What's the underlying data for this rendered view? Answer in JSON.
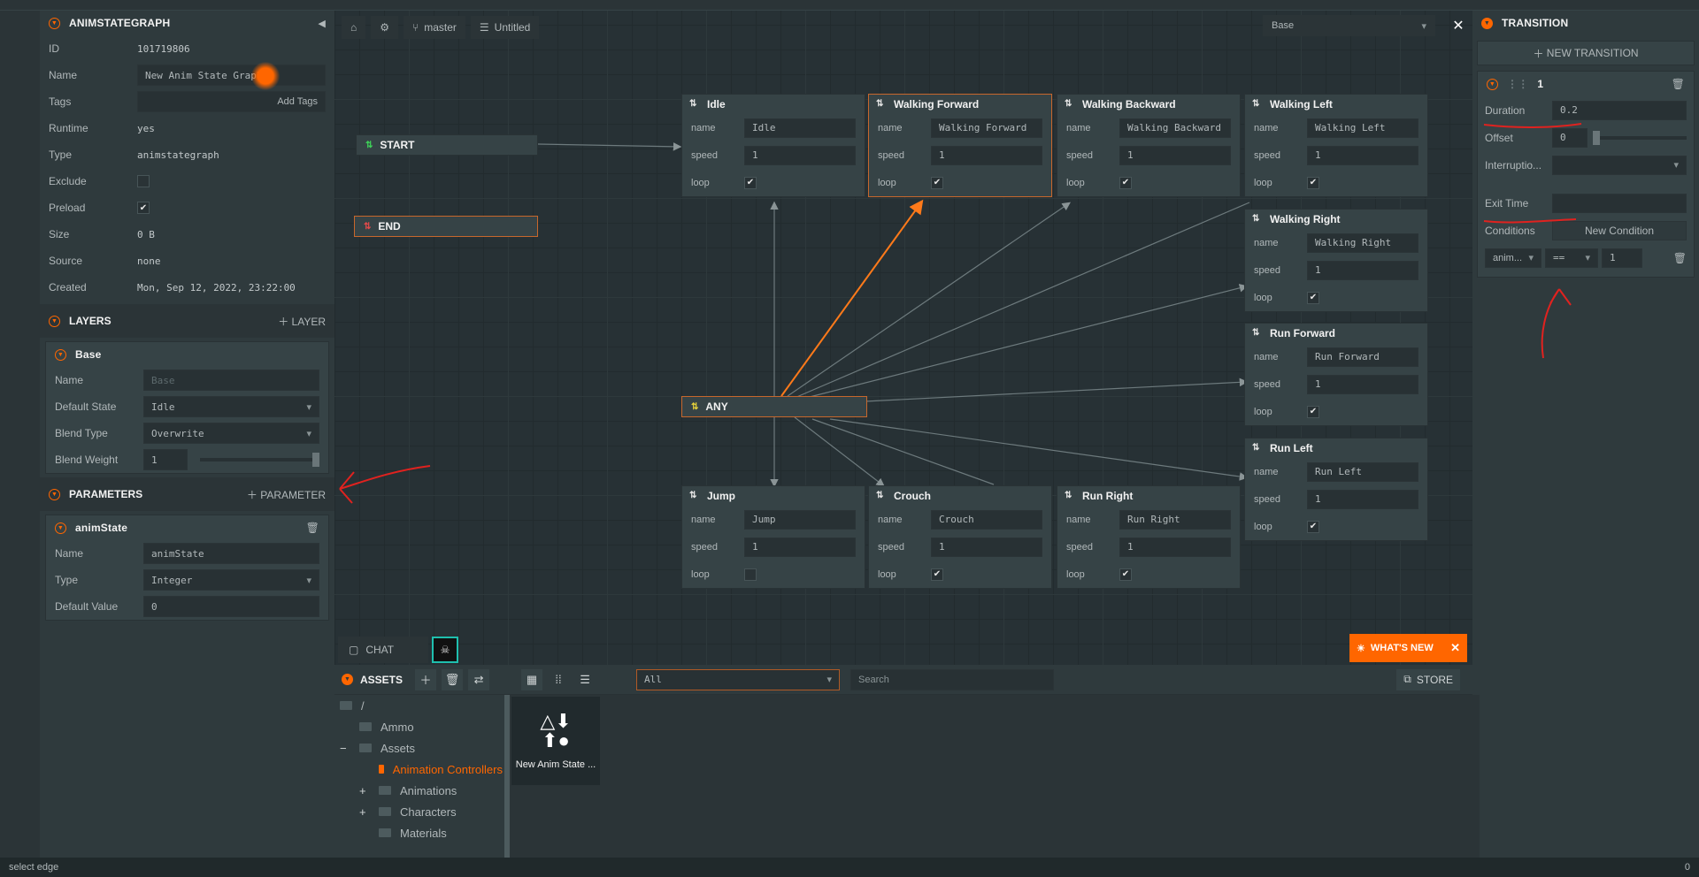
{
  "inspector": {
    "title": "ANIMSTATEGRAPH",
    "rows": [
      {
        "label": "ID",
        "value": "101719806"
      },
      {
        "label": "Name",
        "value": "New Anim State Graph"
      },
      {
        "label": "Tags",
        "value": "Add Tags"
      },
      {
        "label": "Runtime",
        "value": "yes"
      },
      {
        "label": "Type",
        "value": "animstategraph"
      },
      {
        "label": "Exclude",
        "checked": false
      },
      {
        "label": "Preload",
        "checked": true
      },
      {
        "label": "Size",
        "value": "0 B"
      },
      {
        "label": "Source",
        "value": "none"
      },
      {
        "label": "Created",
        "value": "Mon, Sep 12, 2022, 23:22:00"
      }
    ]
  },
  "layers": {
    "title": "LAYERS",
    "add_label": "LAYER",
    "layer": {
      "name": "Base",
      "rows": [
        {
          "label": "Name",
          "value": "Base"
        },
        {
          "label": "Default State",
          "value": "Idle"
        },
        {
          "label": "Blend Type",
          "value": "Overwrite"
        },
        {
          "label": "Blend Weight",
          "value": "1"
        }
      ],
      "blend_weight": 1
    }
  },
  "parameters": {
    "title": "PARAMETERS",
    "add_label": "PARAMETER",
    "param": {
      "name": "animState",
      "rows": [
        {
          "label": "Name",
          "value": "animState"
        },
        {
          "label": "Type",
          "value": "Integer"
        },
        {
          "label": "Default Value",
          "value": "0"
        }
      ]
    }
  },
  "toolbar": {
    "branch": "master",
    "scene": "Untitled",
    "layer_select": "Base"
  },
  "nodes": {
    "start": "START",
    "end": "END",
    "any": "ANY",
    "row_labels": {
      "name": "name",
      "speed": "speed",
      "loop": "loop"
    },
    "states": [
      {
        "title": "Idle",
        "name": "Idle",
        "speed": "1",
        "loop": true
      },
      {
        "title": "Walking Forward",
        "name": "Walking Forward",
        "speed": "1",
        "loop": true
      },
      {
        "title": "Walking Backward",
        "name": "Walking Backward",
        "speed": "1",
        "loop": true
      },
      {
        "title": "Walking Left",
        "name": "Walking Left",
        "speed": "1",
        "loop": true
      },
      {
        "title": "Walking Right",
        "name": "Walking Right",
        "speed": "1",
        "loop": true
      },
      {
        "title": "Run Forward",
        "name": "Run Forward",
        "speed": "1",
        "loop": true
      },
      {
        "title": "Run Left",
        "name": "Run Left",
        "speed": "1",
        "loop": true
      },
      {
        "title": "Jump",
        "name": "Jump",
        "speed": "1",
        "loop": false
      },
      {
        "title": "Crouch",
        "name": "Crouch",
        "speed": "1",
        "loop": true
      },
      {
        "title": "Run Right",
        "name": "Run Right",
        "speed": "1",
        "loop": true
      }
    ]
  },
  "transition": {
    "title": "TRANSITION",
    "new_label": "NEW TRANSITION",
    "index": "1",
    "duration_label": "Duration",
    "duration": "0.2",
    "offset_label": "Offset",
    "offset": "0",
    "offset_level": 0,
    "interruption_label": "Interruptio...",
    "exit_time_label": "Exit Time",
    "conditions_label": "Conditions",
    "new_condition_label": "New Condition",
    "condition": {
      "param": "anim...",
      "op": "==",
      "value": "1"
    }
  },
  "chat": {
    "label": "CHAT"
  },
  "whats_new": {
    "label": "WHAT'S NEW"
  },
  "assets": {
    "title": "ASSETS",
    "filter": "All",
    "search_placeholder": "Search",
    "store_label": "STORE",
    "tree": [
      {
        "label": "/"
      },
      {
        "label": "Ammo"
      },
      {
        "label": "Assets"
      },
      {
        "label": "Animation Controllers"
      },
      {
        "label": "Animations"
      },
      {
        "label": "Characters"
      },
      {
        "label": "Materials"
      }
    ],
    "tiles": [
      {
        "label": "New Anim State ..."
      }
    ]
  },
  "status": {
    "text": "select edge",
    "count": "0"
  },
  "colors": {
    "accent": "#ff6600",
    "panel": "#2f3a3d",
    "canvas": "#273135",
    "node": "#364346"
  }
}
